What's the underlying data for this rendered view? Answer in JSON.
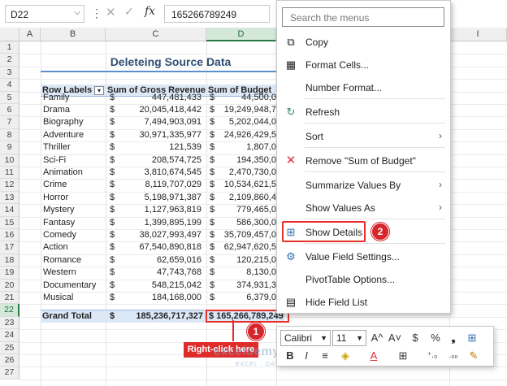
{
  "formula_bar": {
    "name_box": "D22",
    "fx_label": "fx",
    "formula_value": "165266789249"
  },
  "columns": [
    "A",
    "B",
    "C",
    "D",
    "I"
  ],
  "rows": [
    "1",
    "2",
    "3",
    "4",
    "5",
    "6",
    "7",
    "8",
    "9",
    "10",
    "11",
    "12",
    "13",
    "14",
    "15",
    "16",
    "17",
    "18",
    "19",
    "20",
    "21",
    "22",
    "23",
    "24",
    "25",
    "26",
    "27"
  ],
  "sheet": {
    "title": "Deleteing Source Data",
    "headers": {
      "row_labels": "Row Labels",
      "gross": "Sum of Gross Revenue",
      "budget": "Sum of Budget"
    },
    "currency": "$",
    "data": [
      {
        "label": "Family",
        "gross": "447,481,433",
        "budget": "44,500,0"
      },
      {
        "label": "Drama",
        "gross": "20,045,418,442",
        "budget": "19,249,948,7"
      },
      {
        "label": "Biography",
        "gross": "7,494,903,091",
        "budget": "5,202,044,0"
      },
      {
        "label": "Adventure",
        "gross": "30,971,335,977",
        "budget": "24,926,429,5"
      },
      {
        "label": "Thriller",
        "gross": "121,539",
        "budget": "1,807,0"
      },
      {
        "label": "Sci-Fi",
        "gross": "208,574,725",
        "budget": "194,350,0"
      },
      {
        "label": "Animation",
        "gross": "3,810,674,545",
        "budget": "2,470,730,0"
      },
      {
        "label": "Crime",
        "gross": "8,119,707,029",
        "budget": "10,534,621,5"
      },
      {
        "label": "Horror",
        "gross": "5,198,971,387",
        "budget": "2,109,860,4"
      },
      {
        "label": "Mystery",
        "gross": "1,127,963,819",
        "budget": "779,465,0"
      },
      {
        "label": "Fantasy",
        "gross": "1,399,895,199",
        "budget": "586,300,0"
      },
      {
        "label": "Comedy",
        "gross": "38,027,993,497",
        "budget": "35,709,457,0"
      },
      {
        "label": "Action",
        "gross": "67,540,890,818",
        "budget": "62,947,620,5"
      },
      {
        "label": "Romance",
        "gross": "62,659,016",
        "budget": "120,215,0"
      },
      {
        "label": "Western",
        "gross": "47,743,768",
        "budget": "8,130,0"
      },
      {
        "label": "Documentary",
        "gross": "548,215,042",
        "budget": "374,931,3"
      },
      {
        "label": "Musical",
        "gross": "184,168,000",
        "budget": "6,379,0"
      }
    ],
    "total": {
      "label": "Grand Total",
      "gross": "185,236,717,327",
      "budget": "$ 165,266,789,249"
    }
  },
  "context_menu": {
    "search_placeholder": "Search the menus",
    "items": [
      {
        "label": "Copy",
        "icon": "copy-icon"
      },
      {
        "label": "Format Cells...",
        "icon": "format-cells-icon"
      },
      {
        "label": "Number Format...",
        "icon": ""
      },
      {
        "label": "Refresh",
        "icon": "refresh-icon"
      },
      {
        "label": "Sort",
        "icon": ""
      },
      {
        "label": "Remove \"Sum of Budget\"",
        "icon": "remove-icon"
      },
      {
        "label": "Summarize Values By",
        "icon": ""
      },
      {
        "label": "Show Values As",
        "icon": ""
      },
      {
        "label": "Show Details",
        "icon": "show-details-icon"
      },
      {
        "label": "Value Field Settings...",
        "icon": "value-field-settings-icon"
      },
      {
        "label": "PivotTable Options...",
        "icon": ""
      },
      {
        "label": "Hide Field List",
        "icon": "field-list-icon"
      }
    ]
  },
  "mini_toolbar": {
    "font_name": "Calibri",
    "font_size": "11",
    "row1_glyphs": [
      "A^",
      "A˅",
      "$",
      "%",
      "❟",
      "⊞"
    ],
    "row2_glyphs": [
      "B",
      "I",
      "≡",
      "◈",
      "A",
      "⊞",
      "⁺.₀",
      ".₀₀",
      "✎"
    ]
  },
  "annotations": {
    "callout_text": "Right-click here",
    "step1": "1",
    "step2": "2",
    "watermark": "exceldemy",
    "watermark_sub": "EXCEL · DATA · BI"
  },
  "colors": {
    "accent_red": "#e02b2b",
    "header_blue": "#dde8f6",
    "title_blue": "#2f4d73",
    "selected_green": "#2b7a46"
  }
}
